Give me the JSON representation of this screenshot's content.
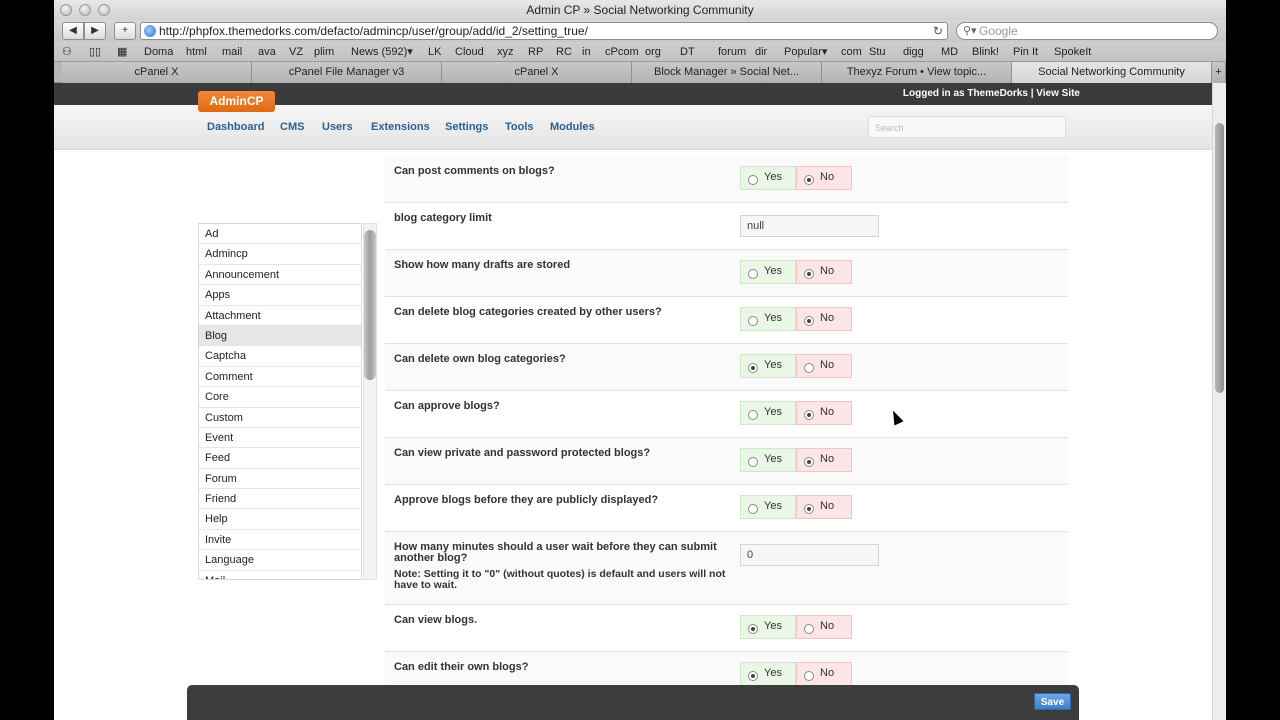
{
  "browser": {
    "window_title": "Admin CP » Social Networking Community",
    "url": "http://phpfox.themedorks.com/defacto/admincp/user/group/add/id_2/setting_true/",
    "search_placeholder": "Google",
    "bookmarks": [
      "Doma",
      "html",
      "mail",
      "ava",
      "VZ",
      "plim",
      "News (592)▾",
      "LK",
      "Cloud",
      "xyz",
      "RP",
      "RC",
      "in",
      "cPcom",
      "org",
      "DT",
      "forum",
      "dir",
      "Popular▾",
      "com",
      "Stu",
      "digg",
      "MD",
      "Blink!",
      "Pin It",
      "SpokeIt"
    ],
    "tabs": [
      {
        "label": "cPanel X",
        "active": false
      },
      {
        "label": "cPanel File Manager v3",
        "active": false
      },
      {
        "label": "cPanel X",
        "active": false
      },
      {
        "label": "Block Manager » Social Net...",
        "active": false
      },
      {
        "label": "Thexyz Forum • View topic...",
        "active": false
      },
      {
        "label": "Social Networking Community",
        "active": true
      }
    ]
  },
  "app": {
    "logo": "AdminCP",
    "logged_in_text": "Logged in as ThemeDorks | View Site",
    "nav": [
      "Dashboard",
      "CMS",
      "Users",
      "Extensions",
      "Settings",
      "Tools",
      "Modules"
    ],
    "search_placeholder": "Search"
  },
  "modules": [
    "Ad",
    "Admincp",
    "Announcement",
    "Apps",
    "Attachment",
    "Blog",
    "Captcha",
    "Comment",
    "Core",
    "Custom",
    "Event",
    "Feed",
    "Forum",
    "Friend",
    "Help",
    "Invite",
    "Language",
    "Mail"
  ],
  "active_module": "Blog",
  "settings": [
    {
      "question": "Can post comments on blogs?",
      "type": "yesno",
      "value": "No"
    },
    {
      "question": "blog category limit",
      "type": "text",
      "value": "null"
    },
    {
      "question": "Show how many drafts are stored",
      "type": "yesno",
      "value": "No"
    },
    {
      "question": "Can delete blog categories created by other users?",
      "type": "yesno",
      "value": "No"
    },
    {
      "question": "Can delete own blog categories?",
      "type": "yesno",
      "value": "Yes"
    },
    {
      "question": "Can approve blogs?",
      "type": "yesno",
      "value": "No"
    },
    {
      "question": "Can view private and password protected blogs?",
      "type": "yesno",
      "value": "No"
    },
    {
      "question": "Approve blogs before they are publicly displayed?",
      "type": "yesno",
      "value": "No"
    },
    {
      "question": "How many minutes should a user wait before they can submit another blog?",
      "note": "Note: Setting it to \"0\" (without quotes) is default and users will not have to wait.",
      "type": "text",
      "value": "0"
    },
    {
      "question": "Can view blogs.",
      "type": "yesno",
      "value": "Yes"
    },
    {
      "question": "Can edit their own blogs?",
      "type": "yesno",
      "value": "Yes"
    }
  ],
  "labels": {
    "yes": "Yes",
    "no": "No",
    "save": "Save"
  }
}
